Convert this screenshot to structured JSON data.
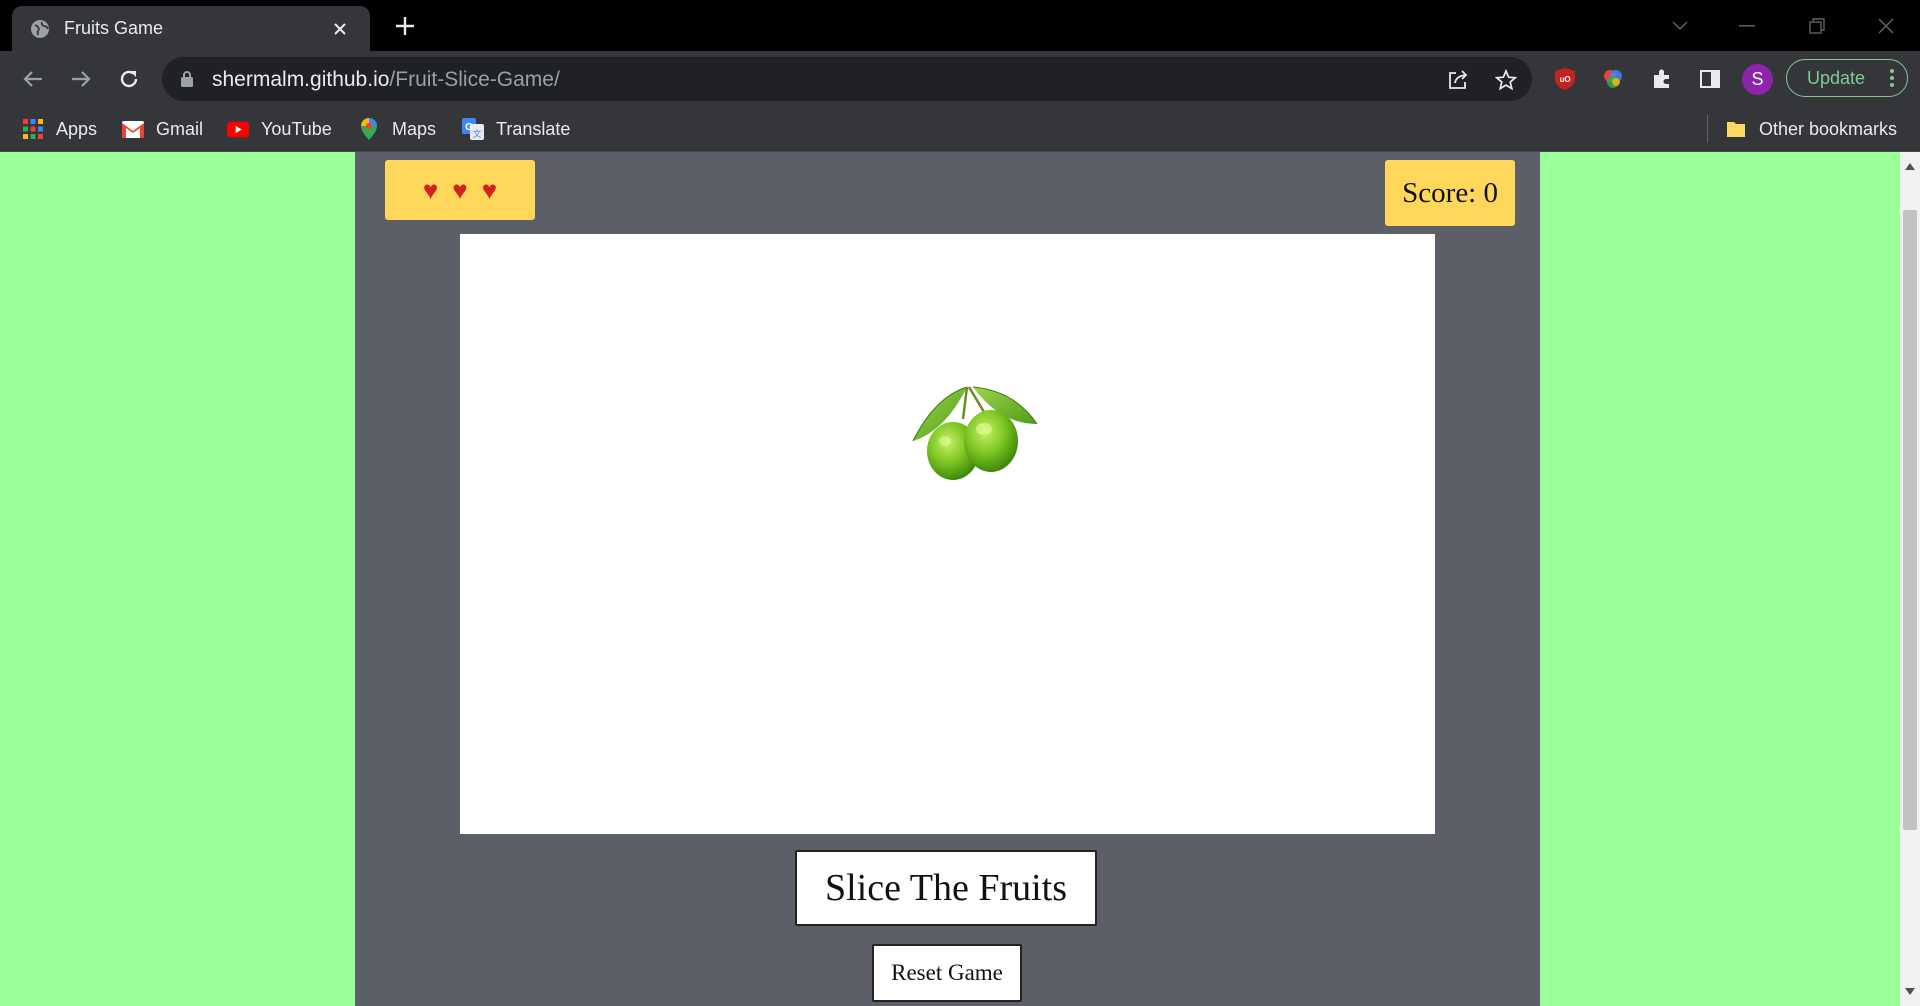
{
  "browser": {
    "tab_title": "Fruits Game",
    "url_host": "shermalm.github.io",
    "url_path": "/Fruit-Slice-Game/",
    "avatar_letter": "S",
    "update_label": "Update",
    "bookmarks": [
      "Apps",
      "Gmail",
      "YouTube",
      "Maps",
      "Translate"
    ],
    "other_bookmarks": "Other bookmarks"
  },
  "game": {
    "lives": [
      "♥",
      "♥",
      "♥"
    ],
    "lives_color": "#d0231b",
    "score_text": "Score: 0",
    "start_label": "Slice The Fruits",
    "reset_label": "Reset Game",
    "fruit_icon": "green-mango-icon"
  },
  "colors": {
    "page_background": "#99ff99",
    "container": "#5c5f67",
    "badge": "#ffd75a"
  }
}
